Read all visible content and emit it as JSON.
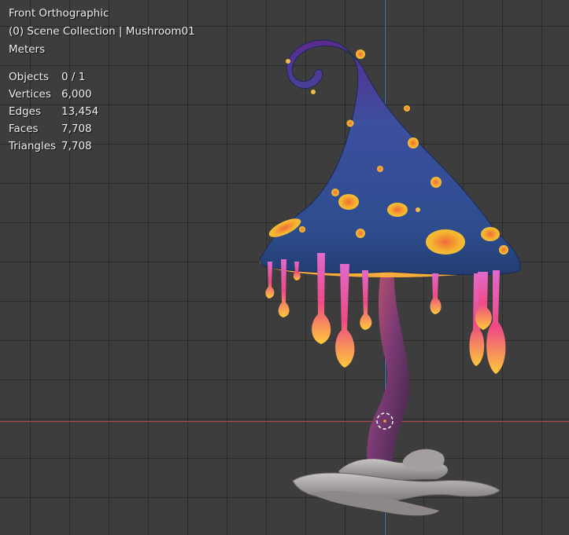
{
  "viewport": {
    "view_name": "Front Orthographic",
    "collection_info": "(0) Scene Collection | Mushroom01",
    "units": "Meters",
    "colors": {
      "background": "#3d3d3d",
      "grid": "#303030",
      "x_axis": "#b0484f",
      "z_axis": "#3f7fbe",
      "text": "#f0f0f0"
    }
  },
  "stats": {
    "rows": [
      {
        "label": "Objects",
        "value": "0 / 1"
      },
      {
        "label": "Vertices",
        "value": "6,000"
      },
      {
        "label": "Edges",
        "value": "13,454"
      },
      {
        "label": "Faces",
        "value": "7,708"
      },
      {
        "label": "Triangles",
        "value": "7,708"
      }
    ]
  },
  "model": {
    "object_name": "Mushroom01",
    "icon": "origin-cursor-icon"
  }
}
